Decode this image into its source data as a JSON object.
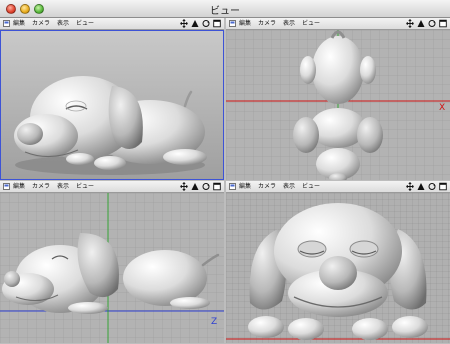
{
  "window": {
    "title": "ビュー"
  },
  "menu": {
    "items": [
      "編集",
      "カメラ",
      "表示",
      "ビュー"
    ]
  },
  "nav_icons": [
    "move-view-icon",
    "zoom-view-icon",
    "rotate-view-icon",
    "maximize-view-icon"
  ],
  "viewports": [
    {
      "id": "perspective",
      "selected": true,
      "axis_label": ""
    },
    {
      "id": "top",
      "selected": false,
      "axis_label": "X"
    },
    {
      "id": "right",
      "selected": false,
      "axis_label": "Z"
    },
    {
      "id": "front",
      "selected": false,
      "axis_label": ""
    }
  ],
  "colors": {
    "selection_border": "#3d53d6",
    "axis_red": "#d11414",
    "axis_green": "#18a018",
    "axis_blue": "#2d3fd0"
  }
}
